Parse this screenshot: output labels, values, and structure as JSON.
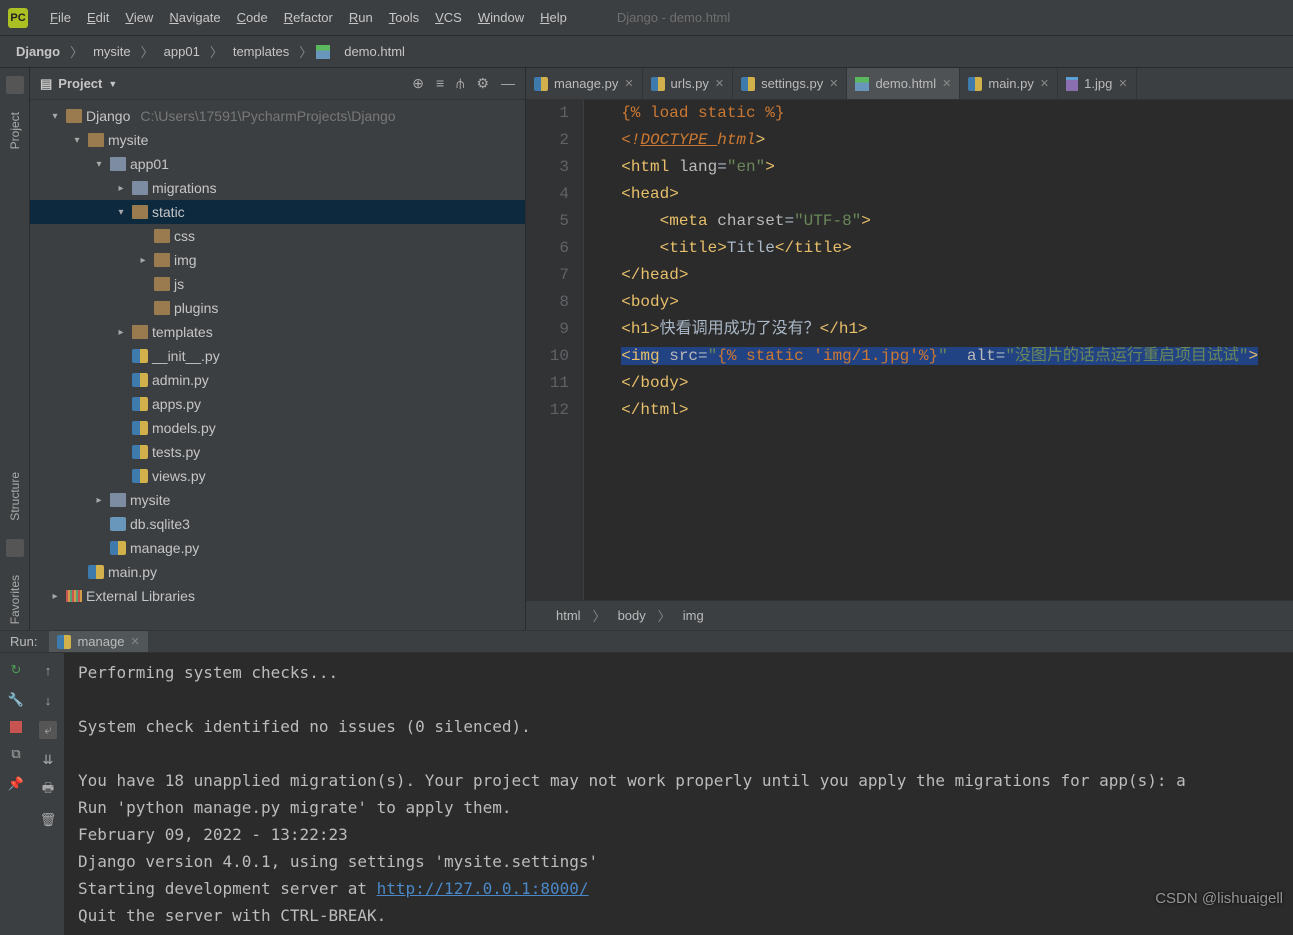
{
  "window_title": "Django - demo.html",
  "menus": [
    "File",
    "Edit",
    "View",
    "Navigate",
    "Code",
    "Refactor",
    "Run",
    "Tools",
    "VCS",
    "Window",
    "Help"
  ],
  "breadcrumbs": [
    "Django",
    "mysite",
    "app01",
    "templates",
    "demo.html"
  ],
  "project_header": "Project",
  "tree": [
    {
      "depth": 0,
      "caret": "v",
      "icon": "folder",
      "label": "Django",
      "extra": "C:\\Users\\17591\\PycharmProjects\\Django"
    },
    {
      "depth": 1,
      "caret": "v",
      "icon": "folder",
      "label": "mysite"
    },
    {
      "depth": 2,
      "caret": "v",
      "icon": "folder-blue",
      "label": "app01"
    },
    {
      "depth": 3,
      "caret": ">",
      "icon": "folder-blue",
      "label": "migrations"
    },
    {
      "depth": 3,
      "caret": "v",
      "icon": "folder",
      "label": "static",
      "selected": true
    },
    {
      "depth": 4,
      "caret": "",
      "icon": "folder",
      "label": "css"
    },
    {
      "depth": 4,
      "caret": ">",
      "icon": "folder",
      "label": "img"
    },
    {
      "depth": 4,
      "caret": "",
      "icon": "folder",
      "label": "js"
    },
    {
      "depth": 4,
      "caret": "",
      "icon": "folder",
      "label": "plugins"
    },
    {
      "depth": 3,
      "caret": ">",
      "icon": "folder",
      "label": "templates"
    },
    {
      "depth": 3,
      "caret": "",
      "icon": "py",
      "label": "__init__.py"
    },
    {
      "depth": 3,
      "caret": "",
      "icon": "py",
      "label": "admin.py"
    },
    {
      "depth": 3,
      "caret": "",
      "icon": "py",
      "label": "apps.py"
    },
    {
      "depth": 3,
      "caret": "",
      "icon": "py",
      "label": "models.py"
    },
    {
      "depth": 3,
      "caret": "",
      "icon": "py",
      "label": "tests.py"
    },
    {
      "depth": 3,
      "caret": "",
      "icon": "py",
      "label": "views.py"
    },
    {
      "depth": 2,
      "caret": ">",
      "icon": "folder-blue",
      "label": "mysite"
    },
    {
      "depth": 2,
      "caret": "",
      "icon": "db",
      "label": "db.sqlite3"
    },
    {
      "depth": 2,
      "caret": "",
      "icon": "py",
      "label": "manage.py"
    },
    {
      "depth": 1,
      "caret": "",
      "icon": "py",
      "label": "main.py"
    },
    {
      "depth": 0,
      "caret": ">",
      "icon": "lib",
      "label": "External Libraries"
    }
  ],
  "tabs": [
    {
      "icon": "py",
      "label": "manage.py"
    },
    {
      "icon": "py",
      "label": "urls.py"
    },
    {
      "icon": "py",
      "label": "settings.py"
    },
    {
      "icon": "html",
      "label": "demo.html",
      "active": true
    },
    {
      "icon": "py",
      "label": "main.py"
    },
    {
      "icon": "img",
      "label": "1.jpg"
    }
  ],
  "code": {
    "lines": [
      "1",
      "2",
      "3",
      "4",
      "5",
      "6",
      "7",
      "8",
      "9",
      "10",
      "11",
      "12"
    ],
    "l1a": "{% load static %}",
    "l2a": "<!",
    "l2b": "DOCTYPE ",
    "l2c": "html",
    "l2d": ">",
    "l3a": "<",
    "l3b": "html ",
    "l3c": "lang",
    "l3d": "=",
    "l3e": "\"en\"",
    "l3f": ">",
    "l4a": "<",
    "l4b": "head",
    "l4c": ">",
    "l5a": "<",
    "l5b": "meta ",
    "l5c": "charset",
    "l5d": "=",
    "l5e": "\"UTF-8\"",
    "l5f": ">",
    "l6a": "<",
    "l6b": "title",
    "l6c": ">",
    "l6d": "Title",
    "l6e": "</",
    "l6f": "title",
    "l6g": ">",
    "l7a": "</",
    "l7b": "head",
    "l7c": ">",
    "l8a": "<",
    "l8b": "body",
    "l8c": ">",
    "l9a": "<",
    "l9b": "h1",
    "l9c": ">",
    "l9d": "快看调用成功了没有？",
    "l9e": "</",
    "l9f": "h1",
    "l9g": ">",
    "l10a": "<",
    "l10b": "img ",
    "l10c": "src",
    "l10d": "=",
    "l10e": "\"",
    "l10f": "{% static 'img/1.jpg'%}",
    "l10g": "\" ",
    "l10h": "alt",
    "l10i": "=",
    "l10j": "\"没图片的话点运行重启项目试试\"",
    "l10k": ">",
    "l11a": "</",
    "l11b": "body",
    "l11c": ">",
    "l12a": "</",
    "l12b": "html",
    "l12c": ">"
  },
  "code_crumbs": [
    "html",
    "body",
    "img"
  ],
  "run": {
    "label": "Run:",
    "tab": "manage",
    "c1": "Performing system checks...",
    "c2": "",
    "c3": "System check identified no issues (0 silenced).",
    "c4": "",
    "c5": "You have 18 unapplied migration(s). Your project may not work properly until you apply the migrations for app(s): a",
    "c6": "Run 'python manage.py migrate' to apply them.",
    "c7": "February 09, 2022 - 13:22:23",
    "c8": "Django version 4.0.1, using settings 'mysite.settings'",
    "c9a": "Starting development server at ",
    "c9b": "http://127.0.0.1:8000/",
    "c10": "Quit the server with CTRL-BREAK."
  },
  "watermark": "CSDN @lishuaigell"
}
